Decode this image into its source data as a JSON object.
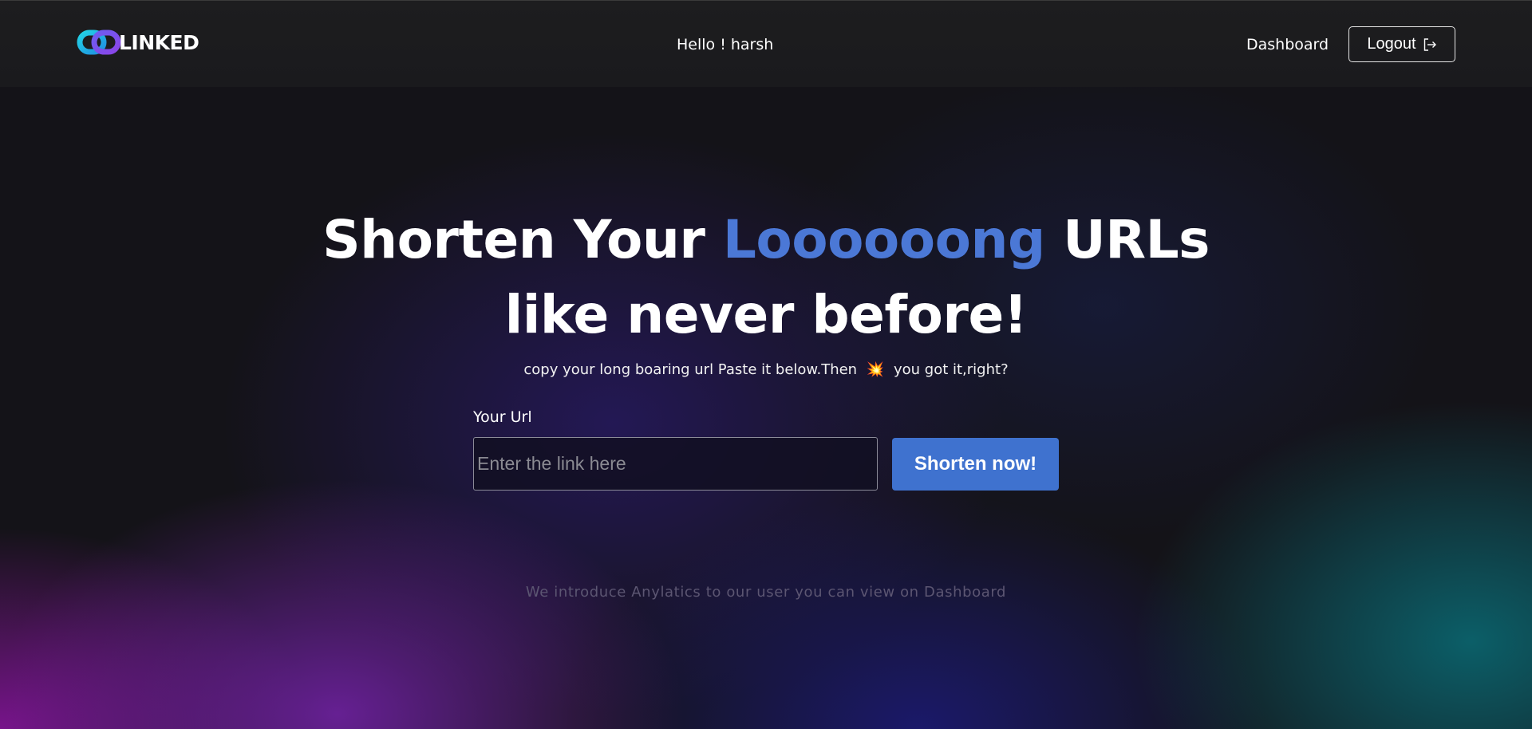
{
  "header": {
    "brand": "LINKED",
    "greeting": "Hello ! harsh",
    "nav_dashboard": "Dashboard",
    "logout_label": "Logout"
  },
  "hero": {
    "title_part1": "Shorten Your ",
    "title_accent": "Loooooong",
    "title_part2": " URLs",
    "title_line2": "like never before!",
    "subtitle_before": "copy your long boaring url Paste it below.Then",
    "subtitle_emoji": "💥",
    "subtitle_after": "you got it,right?"
  },
  "form": {
    "label": "Your Url",
    "placeholder": "Enter the link here",
    "value": "",
    "button_label": "Shorten now!"
  },
  "footnote": "We introduce Anylatics to our user you can view on Dashboard",
  "colors": {
    "accent": "#4b78d6",
    "button": "#3f72cf",
    "background": "#141318"
  },
  "icons": {
    "logo": "chain-link-icon",
    "logout": "logout-icon"
  }
}
